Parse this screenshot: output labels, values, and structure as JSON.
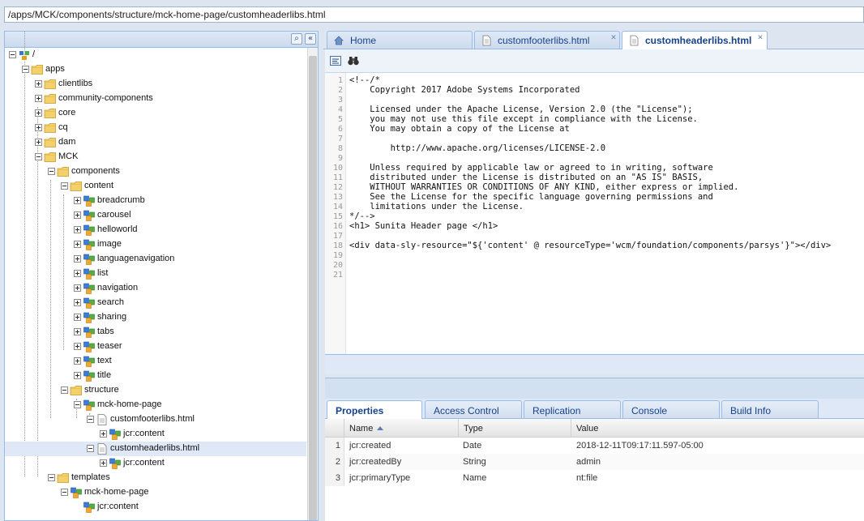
{
  "path_bar": {
    "value": "/apps/MCK/components/structure/mck-home-page/customheaderlibs.html"
  },
  "tree": {
    "rows": [
      {
        "label": "/",
        "icon": "repository-icon"
      },
      {
        "label": "apps",
        "icon": "folder-icon"
      },
      {
        "label": "clientlibs",
        "icon": "folder-icon"
      },
      {
        "label": "community-components",
        "icon": "folder-icon"
      },
      {
        "label": "core",
        "icon": "folder-icon"
      },
      {
        "label": "cq",
        "icon": "folder-icon"
      },
      {
        "label": "dam",
        "icon": "folder-icon"
      },
      {
        "label": "MCK",
        "icon": "folder-icon"
      },
      {
        "label": "components",
        "icon": "folder-icon"
      },
      {
        "label": "content",
        "icon": "folder-icon"
      },
      {
        "label": "breadcrumb",
        "icon": "component-icon"
      },
      {
        "label": "carousel",
        "icon": "component-icon"
      },
      {
        "label": "helloworld",
        "icon": "component-icon"
      },
      {
        "label": "image",
        "icon": "component-icon"
      },
      {
        "label": "languagenavigation",
        "icon": "component-icon"
      },
      {
        "label": "list",
        "icon": "component-icon"
      },
      {
        "label": "navigation",
        "icon": "component-icon"
      },
      {
        "label": "search",
        "icon": "component-icon"
      },
      {
        "label": "sharing",
        "icon": "component-icon"
      },
      {
        "label": "tabs",
        "icon": "component-icon"
      },
      {
        "label": "teaser",
        "icon": "component-icon"
      },
      {
        "label": "text",
        "icon": "component-icon"
      },
      {
        "label": "title",
        "icon": "component-icon"
      },
      {
        "label": "structure",
        "icon": "folder-icon"
      },
      {
        "label": "mck-home-page",
        "icon": "component-icon"
      },
      {
        "label": "customfooterlibs.html",
        "icon": "file-icon"
      },
      {
        "label": "jcr:content",
        "icon": "node-icon"
      },
      {
        "label": "customheaderlibs.html",
        "icon": "file-icon"
      },
      {
        "label": "jcr:content",
        "icon": "node-icon"
      },
      {
        "label": "templates",
        "icon": "folder-icon"
      },
      {
        "label": "mck-home-page",
        "icon": "component-icon"
      },
      {
        "label": "jcr:content",
        "icon": "node-icon"
      }
    ]
  },
  "tabs": [
    {
      "label": "Home",
      "icon": "home-icon"
    },
    {
      "label": "customfooterlibs.html",
      "icon": "file-icon"
    },
    {
      "label": "customheaderlibs.html",
      "icon": "file-icon"
    }
  ],
  "editor": {
    "line_numbers": [
      "1",
      "2",
      "3",
      "4",
      "5",
      "6",
      "7",
      "8",
      "9",
      "10",
      "11",
      "12",
      "13",
      "14",
      "15",
      "16",
      "17",
      "18",
      "19",
      "20",
      "21"
    ],
    "lines": [
      "<!--/*",
      "    Copyright 2017 Adobe Systems Incorporated",
      "",
      "    Licensed under the Apache License, Version 2.0 (the \"License\");",
      "    you may not use this file except in compliance with the License.",
      "    You may obtain a copy of the License at",
      "",
      "        http://www.apache.org/licenses/LICENSE-2.0",
      "",
      "    Unless required by applicable law or agreed to in writing, software",
      "    distributed under the License is distributed on an \"AS IS\" BASIS,",
      "    WITHOUT WARRANTIES OR CONDITIONS OF ANY KIND, either express or implied.",
      "    See the License for the specific language governing permissions and",
      "    limitations under the License.",
      "*/-->",
      "<h1> Sunita Header page </h1>",
      "",
      "<div data-sly-resource=\"${'content' @ resourceType='wcm/foundation/components/parsys'}\"></div>",
      "",
      "",
      ""
    ]
  },
  "bottom_tabs": [
    "Properties",
    "Access Control",
    "Replication",
    "Console",
    "Build Info"
  ],
  "properties": {
    "columns": [
      "Name",
      "Type",
      "Value"
    ],
    "rows": [
      {
        "num": "1",
        "name": "jcr:created",
        "type": "Date",
        "value": "2018-12-11T09:17:11.597-05:00"
      },
      {
        "num": "2",
        "name": "jcr:createdBy",
        "type": "String",
        "value": "admin"
      },
      {
        "num": "3",
        "name": "jcr:primaryType",
        "type": "Name",
        "value": "nt:file"
      }
    ]
  },
  "colors": {
    "accent": "#15428b",
    "border": "#99bbe8",
    "selection": "#dfe8f6"
  }
}
